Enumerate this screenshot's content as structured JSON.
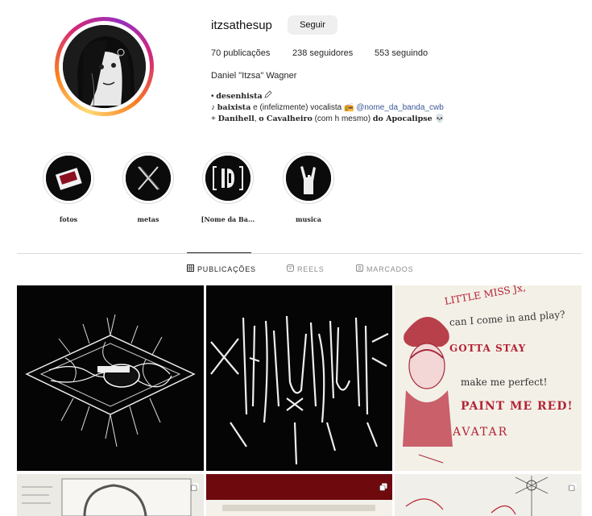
{
  "profile": {
    "username": "itzsathesup",
    "follow_label": "Seguir",
    "stats": {
      "posts": "70 publicações",
      "followers": "238 seguidores",
      "following": "553 seguindo"
    },
    "full_name": "Daniel \"Itzsa\" Wagner",
    "bio": {
      "line1_bullet": "• ",
      "line1_bold": "desenhista",
      "line2_prefix": "♪ ",
      "line2_bold": "baixista",
      "line2_rest": " e (infelizmente) vocalista 📻 ",
      "line2_link": "@nome_da_banda_cwb",
      "line3_prefix": "+ ",
      "line3_bold1": "Danihell",
      "line3_mid1": ", ",
      "line3_bold2": "o Cavalheiro",
      "line3_mid2": " (com h mesmo) ",
      "line3_bold3": "do Apocalipse",
      "line3_end": " 💀"
    }
  },
  "highlights": [
    {
      "label": "fotos"
    },
    {
      "label": "metas"
    },
    {
      "label": "[Nome da Ba..."
    },
    {
      "label": "musica"
    }
  ],
  "tabs": [
    {
      "label": "PUBLICAÇÕES",
      "icon": "grid-icon",
      "active": true
    },
    {
      "label": "REELS",
      "icon": "reels-icon",
      "active": false
    },
    {
      "label": "MARCADOS",
      "icon": "tagged-icon",
      "active": false
    }
  ],
  "posts": [
    {
      "art_text": ""
    },
    {
      "art_text": ""
    },
    {
      "art_lines": [
        "LITTLE MISS Jx,",
        "can I come in and play?",
        "GOTTA STAY",
        "make me perfect!",
        "PAINT ME RED!",
        "AVATAR"
      ]
    }
  ]
}
